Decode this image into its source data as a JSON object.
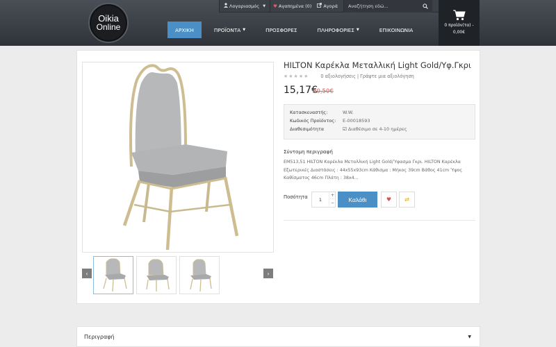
{
  "header": {
    "logo_line1": "Oikia",
    "logo_line2": "Online",
    "topbar": {
      "account": "Λογαριασμός",
      "wishlist": "Αγαπημένα (0)",
      "cart_link": "Αγορά",
      "search_placeholder": "Αναζήτηση εδώ..."
    },
    "cart": {
      "line1": "0 προϊόν(τα) -",
      "line2": "0,00€"
    },
    "nav": [
      {
        "label": "ΑΡΧΙΚΗ",
        "active": true,
        "dropdown": false
      },
      {
        "label": "ΠΡΟΪΟΝΤΑ",
        "active": false,
        "dropdown": true
      },
      {
        "label": "ΠΡΟΣΦΟΡΕΣ",
        "active": false,
        "dropdown": false
      },
      {
        "label": "ΠΛΗΡΟΦΟΡΙΕΣ",
        "active": false,
        "dropdown": true
      },
      {
        "label": "ΕΠΙΚΟΙΝΩΝΙΑ",
        "active": false,
        "dropdown": false
      }
    ],
    "accent_color": "#4a90c6"
  },
  "product": {
    "title": "HILTON Καρέκλα Μεταλλική Light Gold/Υφ.Γκρι",
    "stars": "★★★★★",
    "reviews": "0 αξιολογήσεις",
    "write_review": "Γράψτε μια αξιολόγηση",
    "price": "15,17€",
    "old_price": "20,50€",
    "info": {
      "manufacturer_label": "Κατασκευαστής:",
      "manufacturer_value": "W.W.",
      "code_label": "Κωδικός Προϊόντος:",
      "code_value": "Ε-00018593",
      "availability_label": "Διαθεσιμότητα",
      "availability_value": "Διαθέσιμο σε 4-10 ημέρες"
    },
    "short_desc_title": "Σύντομη περιγραφή",
    "short_desc": "ΕΜ513,51 HILTON Καρέκλα Μεταλλική Light Gold/Ύφασμα Γκρι. HILTON Καρέκλα Εξωτερικές Διαστάσεις : 44x55x93cm Κάθισμα : Μήκος 39cm Βάθος 41cm Ύψος Καθίσματος 46cm Πλάτη : 38x4...",
    "qty_label": "Ποσότητα",
    "qty_value": "1",
    "add_to_cart": "Καλάθι",
    "thumb_count": 3
  },
  "description_tab": {
    "label": "Περιγραφή"
  }
}
